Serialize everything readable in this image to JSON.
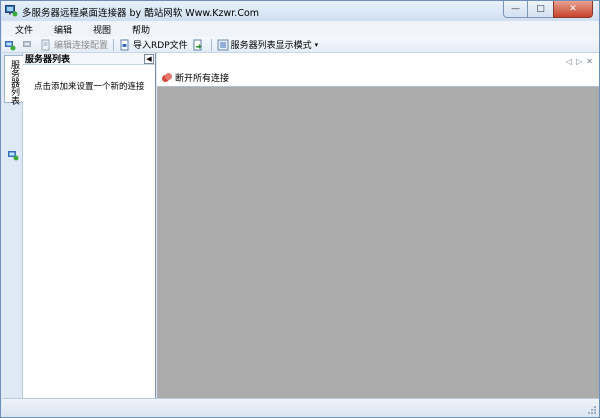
{
  "window": {
    "title": "多服务器远程桌面连接器 by 酷站网软 Www.Kzwr.Com",
    "icons": {
      "app": "remote-desktop-icon",
      "minimize": "minimize-icon",
      "maximize": "maximize-icon",
      "close": "close-icon"
    },
    "captions": {
      "minimize": "—",
      "maximize": "□",
      "close": "✕"
    }
  },
  "menu": {
    "items": [
      "文件",
      "编辑",
      "视图",
      "帮助"
    ]
  },
  "toolbar": {
    "connect_icon": "connect-icon",
    "disconnect_icon": "disconnect-icon",
    "edit_label": "编辑连接配置",
    "import_label": "导入RDP文件",
    "export_icon": "export-icon",
    "view_mode_label": "服务器列表显示模式",
    "dropdown_arrow": "▾"
  },
  "sidebar": {
    "tab_label": "服务器列表",
    "panel_title": "服务器列表",
    "collapse_glyph": "◀",
    "hint": "点击添加来设置一个新的连接"
  },
  "content": {
    "tabnav_prev": "◁",
    "tabnav_next": "▷",
    "tabnav_close": "✕",
    "disconnect_all_label": "断开所有连接"
  },
  "colors": {
    "canvas": "#ababab",
    "frame": "#dfe9f5",
    "close_button": "#c7432b"
  }
}
